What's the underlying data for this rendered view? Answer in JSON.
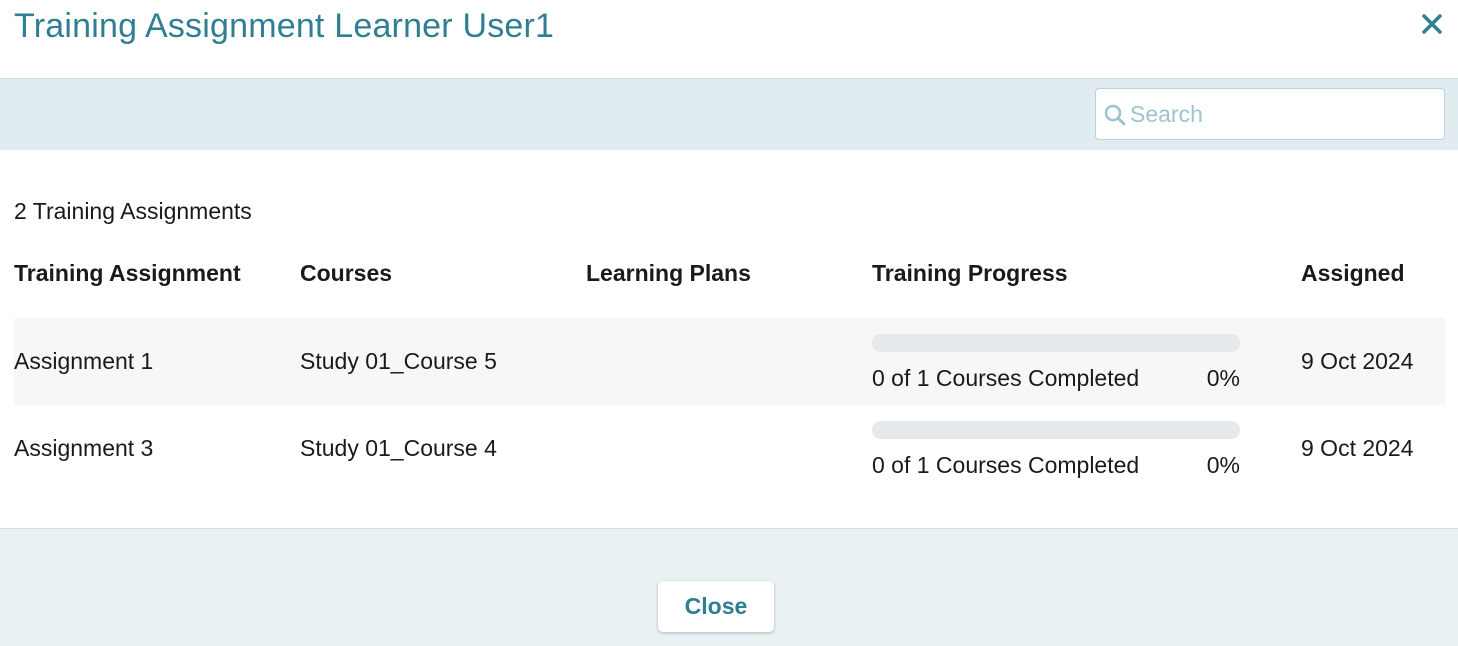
{
  "dialog": {
    "title": "Training Assignment Learner User1",
    "close_icon": "close-icon"
  },
  "search": {
    "placeholder": "Search",
    "value": "",
    "icon": "search-icon"
  },
  "summary": {
    "count_label": "2 Training Assignments"
  },
  "table": {
    "columns": [
      "Training Assignment",
      "Courses",
      "Learning Plans",
      "Training Progress",
      "Assigned"
    ],
    "rows": [
      {
        "assignment": "Assignment 1",
        "courses": "Study 01_Course 5",
        "learning_plans": "",
        "progress_text": "0 of 1 Courses Completed",
        "progress_percent_label": "0%",
        "progress_fraction": 0,
        "assigned": "9 Oct 2024"
      },
      {
        "assignment": "Assignment 3",
        "courses": "Study 01_Course 4",
        "learning_plans": "",
        "progress_text": "0 of 1 Courses Completed",
        "progress_percent_label": "0%",
        "progress_fraction": 0,
        "assigned": "9 Oct 2024"
      }
    ]
  },
  "footer": {
    "close_label": "Close"
  },
  "colors": {
    "accent": "#2f7f93",
    "toolbar_bg": "#e0ecf0",
    "footer_bg": "#e9f1f4",
    "row_alt_bg": "#f7f7f7",
    "progress_track": "#e5e9eb"
  }
}
